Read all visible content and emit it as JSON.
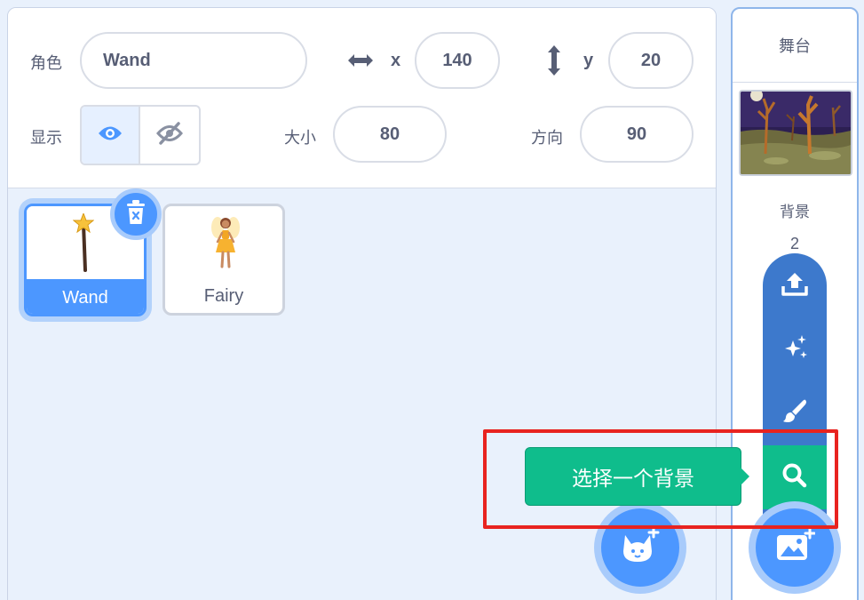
{
  "sprite_info": {
    "sprite_label": "角色",
    "sprite_name": "Wand",
    "x_label": "x",
    "x_value": "140",
    "y_label": "y",
    "y_value": "20",
    "show_label": "显示",
    "size_label": "大小",
    "size_value": "80",
    "direction_label": "方向",
    "direction_value": "90"
  },
  "sprites": [
    {
      "name": "Wand",
      "selected": true,
      "icon": "wand-icon"
    },
    {
      "name": "Fairy",
      "selected": false,
      "icon": "fairy-icon"
    }
  ],
  "stage": {
    "title": "舞台",
    "backdrop_label": "背景",
    "backdrop_count": "2"
  },
  "backdrop_menu": {
    "items": [
      "upload-icon",
      "surprise-icon",
      "paint-icon",
      "search-icon"
    ],
    "tooltip": "选择一个背景"
  },
  "colors": {
    "accent": "#4c97ff",
    "menu": "#3d79cc",
    "active": "#0fbd8c",
    "highlight": "#e8231f"
  }
}
